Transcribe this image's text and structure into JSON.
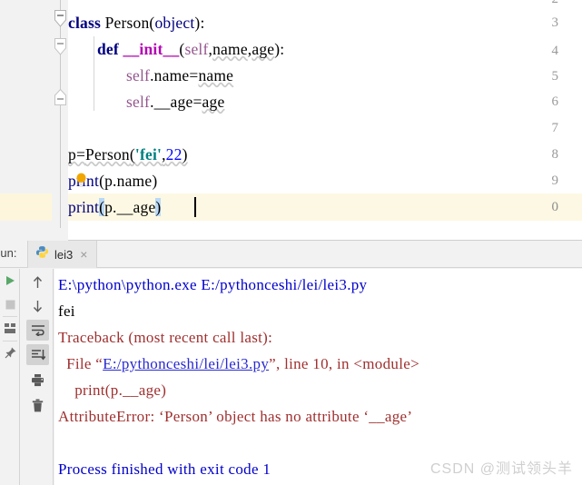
{
  "editor": {
    "lines": [
      {
        "num": "2",
        "text": ""
      },
      {
        "num": "3",
        "text": "class Person(object):"
      },
      {
        "num": "4",
        "text": "    def __init__(self,name,age):"
      },
      {
        "num": "5",
        "text": "        self.name=name"
      },
      {
        "num": "6",
        "text": "        self.__age=age"
      },
      {
        "num": "7",
        "text": ""
      },
      {
        "num": "8",
        "text": "p=Person('fei',22)"
      },
      {
        "num": "9",
        "text": "print(p.name)"
      },
      {
        "num": "0",
        "text": "print(p.__age)"
      }
    ],
    "tokens": {
      "kw_class": "class",
      "cls_name": "Person",
      "object": "object",
      "kw_def": "def",
      "init": "__init__",
      "self": "self",
      "name": "name",
      "age": "age",
      "p": "p",
      "str_fei": "'fei'",
      "num_22": "22",
      "print": "print",
      "dunder_age": "__age"
    },
    "current_line": "10",
    "bulb_icon": "intention-bulb-icon"
  },
  "run_panel": {
    "label": "Run:",
    "tab": {
      "name": "lei3",
      "icon": "python-file-icon",
      "close": "×"
    },
    "toolbar_left": [
      {
        "name": "rerun-button",
        "icon": "green-play-icon"
      },
      {
        "name": "stop-button",
        "icon": "stop-square-icon"
      },
      {
        "name": "layout-button",
        "icon": "layout-icon"
      },
      {
        "name": "pin-tab-button",
        "icon": "pin-icon"
      }
    ],
    "toolbar_console": [
      {
        "name": "up-the-stack-button",
        "icon": "arrow-up-icon",
        "active": false
      },
      {
        "name": "down-the-stack-button",
        "icon": "arrow-down-icon",
        "active": false
      },
      {
        "name": "soft-wrap-button",
        "icon": "soft-wrap-icon",
        "active": true
      },
      {
        "name": "scroll-to-end-button",
        "icon": "scroll-end-icon",
        "active": true
      },
      {
        "name": "print-button",
        "icon": "printer-icon",
        "active": false
      },
      {
        "name": "clear-all-button",
        "icon": "trash-icon",
        "active": false
      }
    ],
    "output": [
      {
        "id": "cmd",
        "kind": "cmd",
        "text": "E:\\python\\python.exe E:/pythonceshi/lei/lei3.py"
      },
      {
        "id": "stdout",
        "kind": "std",
        "text": "fei"
      },
      {
        "id": "tb-head",
        "kind": "err",
        "text": "Traceback (most recent call last):"
      },
      {
        "id": "tb-file",
        "kind": "err",
        "pre": "  File “",
        "link": "E:/pythonceshi/lei/lei3.py",
        "post": "”, line 10, in <module>"
      },
      {
        "id": "tb-code",
        "kind": "err",
        "text": "    print(p.__age)"
      },
      {
        "id": "tb-error",
        "kind": "err",
        "text": "AttributeError: ‘Person’ object has no attribute ‘__age’"
      },
      {
        "id": "proc-done",
        "kind": "cmd",
        "text": "Process finished with exit code 1"
      }
    ]
  },
  "watermark": "CSDN @测试领头羊",
  "colors": {
    "keyword": "#000080",
    "string": "#008080",
    "number": "#0000ff",
    "self": "#94558d",
    "dunder": "#b200b2",
    "error": "#a03030",
    "link": "#2929d0",
    "command": "#0000cc",
    "current_line_bg": "#fdf8e3",
    "bracket_highlight": "#b9d9f7",
    "gutter_bg": "#f2f2f2"
  }
}
